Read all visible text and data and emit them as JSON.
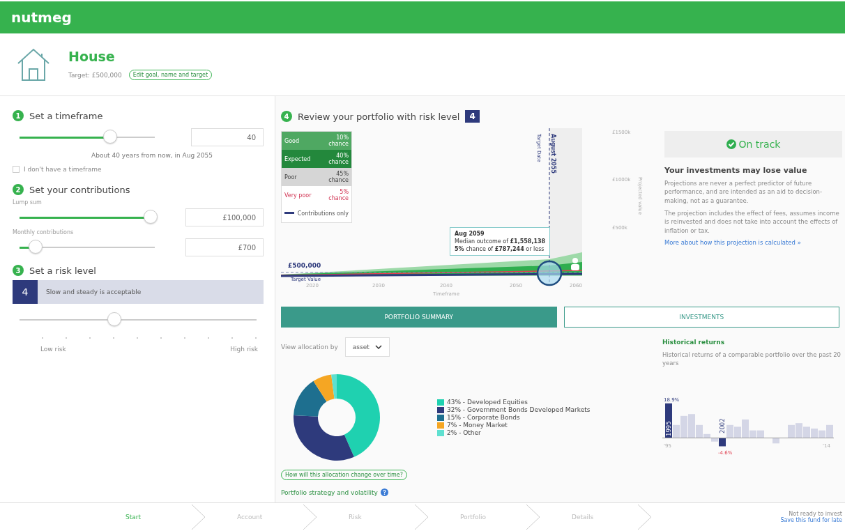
{
  "brand": "nutmeg",
  "goal": {
    "title": "House",
    "target": "Target: £500,000",
    "edit_link": "Edit goal, name and target"
  },
  "timeframe": {
    "step": "1",
    "heading": "Set a timeframe",
    "level": 0.67,
    "value": "40",
    "note": "About 40 years from now, in Aug 2055",
    "checkbox": {
      "label": "I don't have a timeframe",
      "checked": false
    }
  },
  "contributions": {
    "step": "2",
    "heading": "Set your contributions",
    "sliders": [
      {
        "label": "Lump sum",
        "level": 0.97,
        "value": "£100,000"
      },
      {
        "label": "Monthly contributions",
        "level": 0.12,
        "value": "£700"
      }
    ]
  },
  "risk": {
    "step": "3",
    "heading": "Set a risk level",
    "badge": "4",
    "description": "Slow and steady is acceptable",
    "level": 0.4,
    "low_label": "Low risk",
    "high_label": "High risk"
  },
  "review": {
    "step": "4",
    "heading": "Review your portfolio with risk level",
    "badge": "4"
  },
  "projection": {
    "legend": [
      {
        "kind": "good",
        "name": "Good",
        "chance": "10% chance"
      },
      {
        "kind": "expected",
        "name": "Expected",
        "chance": "40% chance"
      },
      {
        "kind": "poor",
        "name": "Poor",
        "chance": "45% chance"
      },
      {
        "kind": "very_poor",
        "name": "Very poor",
        "chance": "5% chance"
      },
      {
        "kind": "line",
        "name": "Contributions only"
      }
    ],
    "y_labels": [
      "£1500k",
      "£1000k",
      "£500k"
    ],
    "y_title": "Projected value",
    "x_labels": [
      "2020",
      "2030",
      "2040",
      "2050",
      "2060"
    ],
    "x_title": "Timeframe",
    "target_date": "August 2055",
    "target_date_label": "Target Date",
    "target_value": "£500,000",
    "target_value_label": "Target Value",
    "tooltip": {
      "date": "Aug 2059",
      "median": "Median outcome of **£1,558,138**",
      "low": "**5%** chance of **£787,244** or less"
    }
  },
  "status": {
    "label": "On track",
    "on_track": true
  },
  "info": {
    "heading": "Your investments may lose value",
    "paragraphs": [
      "Projections are never a perfect predictor of future performance, and are intended as an aid to decision-making, not as a guarantee.",
      "The projection includes the effect of fees, assumes income is reinvested and does not take into account the effects of inflation or tax."
    ],
    "link": "More about how this projection is calculated »"
  },
  "tabs": [
    {
      "label": "PORTFOLIO SUMMARY",
      "selected": true
    },
    {
      "label": "INVESTMENTS",
      "selected": false
    }
  ],
  "allocation": {
    "label": "View allocation by",
    "select": "asset",
    "chart_data": {
      "type": "donut",
      "categories": [
        "43% - Developed Equities",
        "32% - Government Bonds Developed Markets",
        "15% - Corporate Bonds",
        "7% - Money Market",
        "2% - Other"
      ],
      "series": [
        {
          "values": [
            43,
            32,
            15,
            7,
            2
          ]
        }
      ]
    },
    "legend": [
      {
        "color": "#1fd1b0"
      },
      {
        "color": "#2e3a7c"
      },
      {
        "color": "#1e6f8f"
      },
      {
        "color": "#f5a623"
      },
      {
        "color": "#5fe0d0"
      }
    ],
    "change_link": "How will this allocation change over time?",
    "strategy_link": "Portfolio strategy and volatility"
  },
  "historical": {
    "heading": "Historical returns",
    "description": "Historical returns of a comparable portfolio over the past 20 years",
    "high_value": "18.9%",
    "high_year": "1995",
    "low_value": "-4.6%",
    "low_year": "2002",
    "start": "'95",
    "end": "'14"
  },
  "steps": [
    {
      "label": "Start",
      "selected": true
    },
    {
      "label": "Account",
      "selected": false
    },
    {
      "label": "Risk",
      "selected": false
    },
    {
      "label": "Portfolio",
      "selected": false
    },
    {
      "label": "Details",
      "selected": false
    }
  ],
  "save": {
    "prompt": "Not ready to invest",
    "link": "Save this fund for late"
  }
}
